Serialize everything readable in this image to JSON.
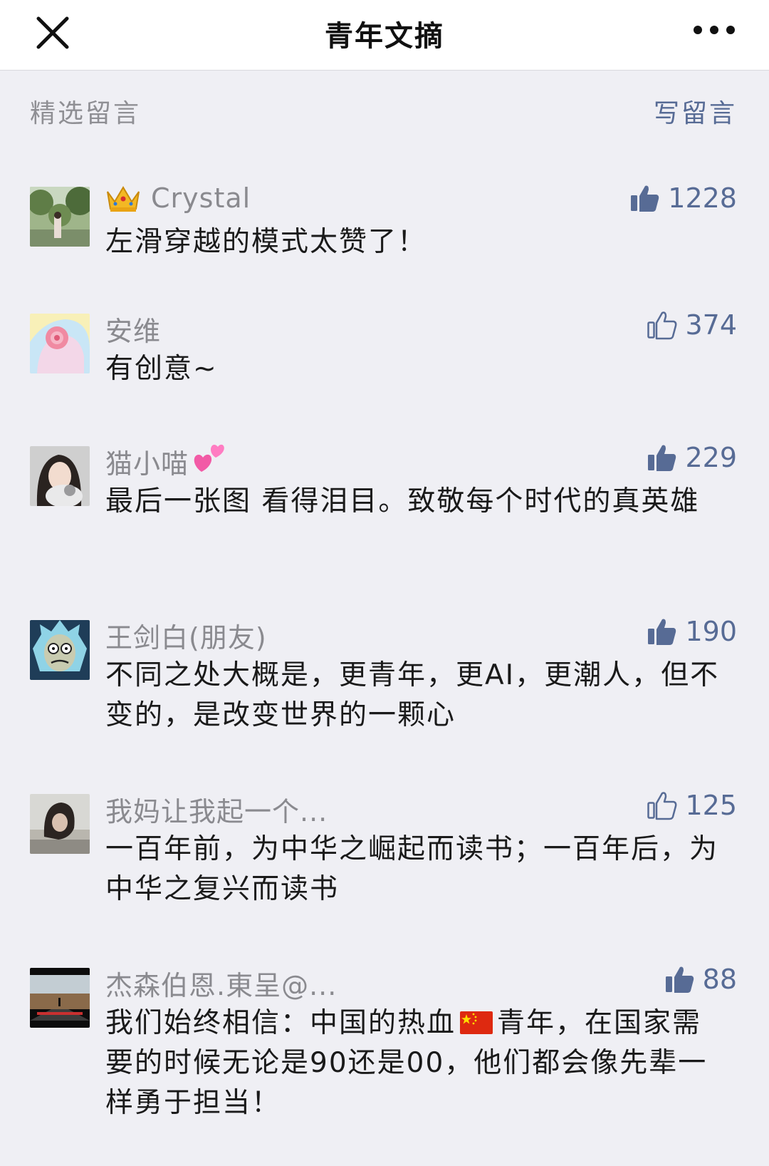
{
  "header": {
    "title": "青年文摘",
    "close_icon": "close-icon",
    "more_icon": "more-dots-icon"
  },
  "section": {
    "title": "精选留言",
    "write_label": "写留言"
  },
  "colors": {
    "link": "#576b95",
    "muted": "#8a8a8f",
    "background": "#efeff4"
  },
  "comments": [
    {
      "name": "Crystal",
      "badge": "crown-emoji",
      "likes": "1228",
      "liked": true,
      "text": "左滑穿越的模式太赞了！"
    },
    {
      "name": "安维",
      "likes": "374",
      "liked": false,
      "text": "有创意~"
    },
    {
      "name": "猫小喵",
      "badge_after": "two-hearts-emoji",
      "likes": "229",
      "liked": true,
      "text": "最后一张图 看得泪目。致敬每个时代的真英雄"
    },
    {
      "name": "王剑白(朋友)",
      "likes": "190",
      "liked": true,
      "text": "不同之处大概是，更青年，更AI，更潮人，但不变的，是改变世界的一颗心"
    },
    {
      "name": "我妈让我起一个...",
      "likes": "125",
      "liked": false,
      "text": "一百年前，为中华之崛起而读书；一百年后，为中华之复兴而读书"
    },
    {
      "name": "杰森伯恩.東呈@...",
      "likes": "88",
      "liked": true,
      "text_before_flag": "我们始终相信：中国的热血",
      "text_after_flag": "青年，在国家需要的时候无论是90还是00，他们都会像先辈一样勇于担当！"
    }
  ]
}
